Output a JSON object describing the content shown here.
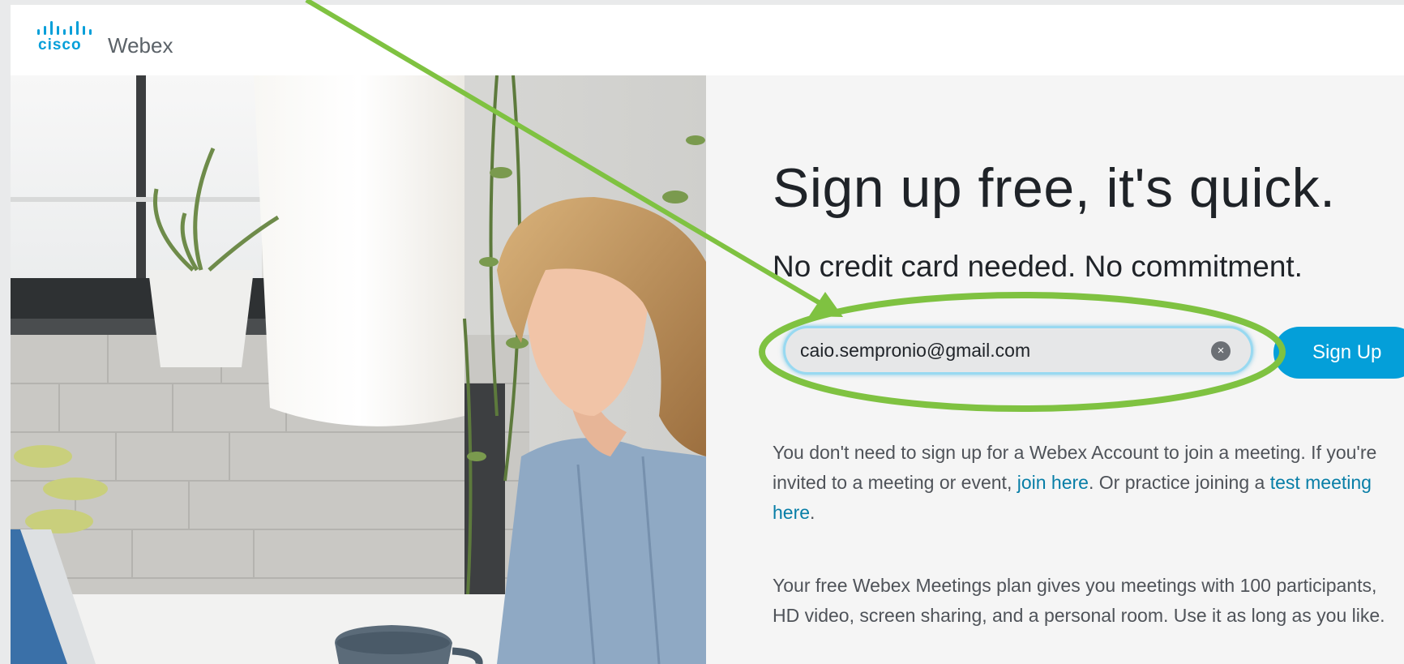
{
  "header": {
    "logo_cisco": "cisco",
    "logo_webex": "Webex"
  },
  "hero": {
    "image_desc": "woman-at-laptop-photo"
  },
  "signup": {
    "headline": "Sign up free, it's quick.",
    "subhead": "No credit card needed. No commitment.",
    "email_value": "caio.sempronio@gmail.com",
    "clear_icon": "×",
    "button_label": "Sign Up"
  },
  "info": {
    "p1_part1": "You don't need to sign up for a Webex Account to join a meeting. If you're invited to a meeting or event, ",
    "p1_link1": "join here",
    "p1_part2": ". Or practice joining a ",
    "p1_link2": "test meeting here",
    "p1_part3": ".",
    "p2": "Your free Webex Meetings plan gives you meetings with 100 participants, HD video, screen sharing, and a personal room. Use it as long as you like."
  },
  "colors": {
    "brand_blue": "#049fd9",
    "link": "#087ea7",
    "annotation_green": "#7fc241"
  }
}
